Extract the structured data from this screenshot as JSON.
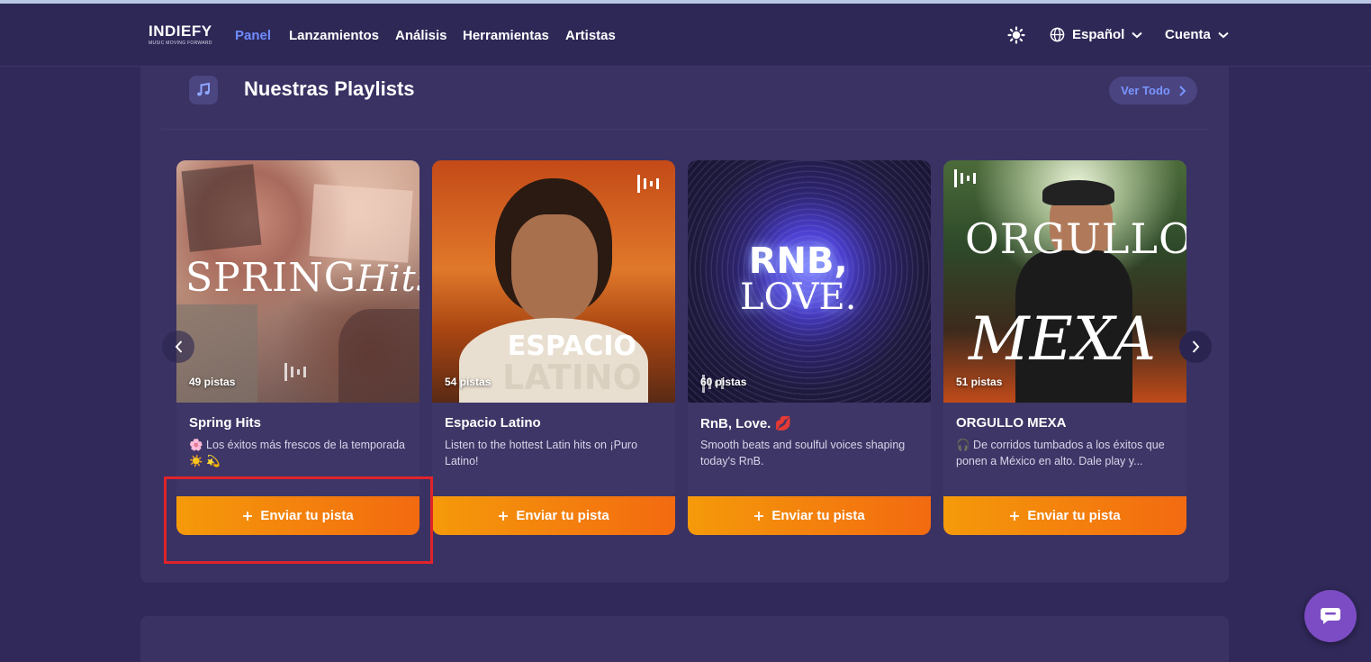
{
  "brand": {
    "name": "INDIEFY",
    "tagline": "MUSIC MOVING FORWARD"
  },
  "nav": {
    "items": [
      {
        "label": "Panel",
        "active": true
      },
      {
        "label": "Lanzamientos",
        "active": false
      },
      {
        "label": "Análisis",
        "active": false
      },
      {
        "label": "Herramientas",
        "active": false
      },
      {
        "label": "Artistas",
        "active": false
      }
    ],
    "language": "Español",
    "account": "Cuenta",
    "accent_color": "#6f8cff"
  },
  "section": {
    "title": "Nuestras Playlists",
    "see_all": "Ver Todo",
    "icon": "music-note-icon"
  },
  "cards": [
    {
      "count": "49 pistas",
      "title": "Spring Hits",
      "desc": "🌸 Los éxitos más frescos de la temporada ☀️ 💫",
      "cta": "Enviar tu pista",
      "cover_text": "SPRING Hits"
    },
    {
      "count": "54 pistas",
      "title": "Espacio Latino",
      "desc": "Listen to the hottest Latin hits on ¡Puro Latino!",
      "cta": "Enviar tu pista",
      "cover_text": "ESPACIO LATINO"
    },
    {
      "count": "60 pistas",
      "title": "RnB, Love. 💋",
      "desc": "Smooth beats and soulful voices shaping today's RnB.",
      "cta": "Enviar tu pista",
      "cover_text": "RNB, LOVE."
    },
    {
      "count": "51 pistas",
      "title": "ORGULLO MEXA",
      "desc": "🎧 De corridos tumbados a los éxitos que ponen a México en alto. Dale play y...",
      "cta": "Enviar tu pista",
      "cover_text": "ORGULLO MEXA"
    }
  ],
  "cta_gradient": [
    "#f59a0a",
    "#f36a10"
  ],
  "highlight_color": "#e0242a"
}
